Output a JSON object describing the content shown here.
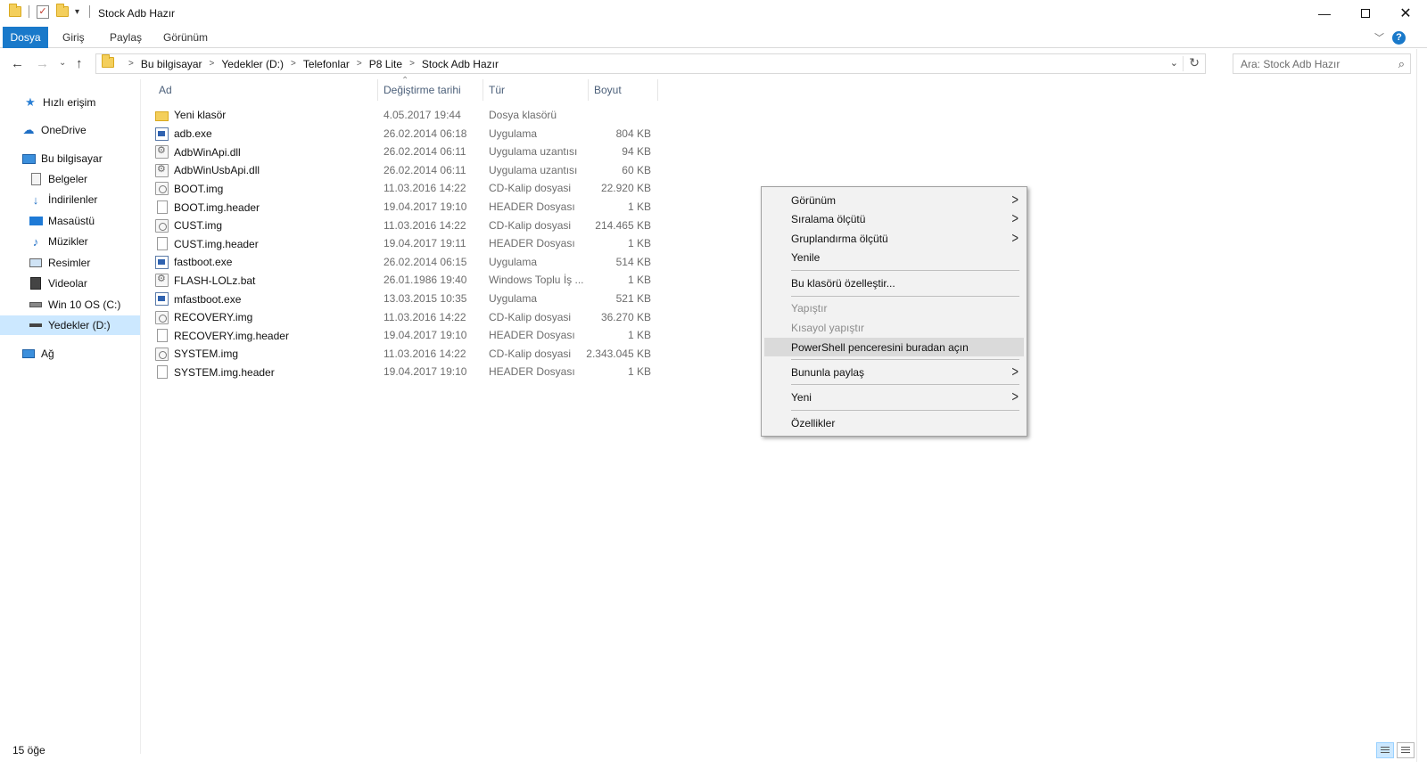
{
  "window": {
    "title": "Stock Adb Hazır",
    "minimize_icon": "minimize-icon",
    "maximize_icon": "maximize-icon",
    "close_icon": "close-icon"
  },
  "ribbon": {
    "tabs": [
      "Dosya",
      "Giriş",
      "Paylaş",
      "Görünüm"
    ],
    "accent": "#1979ca"
  },
  "address": {
    "breadcrumbs": [
      "Bu bilgisayar",
      "Yedekler (D:)",
      "Telefonlar",
      "P8 Lite",
      "Stock Adb Hazır"
    ]
  },
  "search": {
    "placeholder": "Ara: Stock Adb Hazır"
  },
  "nav": {
    "items": [
      {
        "label": "Hızlı erişim",
        "icon": "star-icon"
      },
      {
        "label": "OneDrive",
        "icon": "cloud-icon"
      },
      {
        "label": "Bu bilgisayar",
        "icon": "computer-icon"
      },
      {
        "label": "Belgeler",
        "icon": "documents-icon"
      },
      {
        "label": "İndirilenler",
        "icon": "download-icon"
      },
      {
        "label": "Masaüstü",
        "icon": "desktop-icon"
      },
      {
        "label": "Müzikler",
        "icon": "music-icon"
      },
      {
        "label": "Resimler",
        "icon": "pictures-icon"
      },
      {
        "label": "Videolar",
        "icon": "videos-icon"
      },
      {
        "label": "Win 10 OS (C:)",
        "icon": "drive-icon"
      },
      {
        "label": "Yedekler (D:)",
        "icon": "drive-icon"
      },
      {
        "label": "Ağ",
        "icon": "network-icon"
      }
    ]
  },
  "columns": {
    "name": "Ad",
    "date": "Değiştirme tarihi",
    "type": "Tür",
    "size": "Boyut"
  },
  "files": [
    {
      "name": "Yeni klasör",
      "date": "4.05.2017 19:44",
      "type": "Dosya klasörü",
      "size": "",
      "icon": "folder"
    },
    {
      "name": "adb.exe",
      "date": "26.02.2014 06:18",
      "type": "Uygulama",
      "size": "804 KB",
      "icon": "exe"
    },
    {
      "name": "AdbWinApi.dll",
      "date": "26.02.2014 06:11",
      "type": "Uygulama uzantısı",
      "size": "94 KB",
      "icon": "dll"
    },
    {
      "name": "AdbWinUsbApi.dll",
      "date": "26.02.2014 06:11",
      "type": "Uygulama uzantısı",
      "size": "60 KB",
      "icon": "dll"
    },
    {
      "name": "BOOT.img",
      "date": "11.03.2016 14:22",
      "type": "CD-Kalip dosyasi",
      "size": "22.920 KB",
      "icon": "img"
    },
    {
      "name": "BOOT.img.header",
      "date": "19.04.2017 19:10",
      "type": "HEADER Dosyası",
      "size": "1 KB",
      "icon": "doc"
    },
    {
      "name": "CUST.img",
      "date": "11.03.2016 14:22",
      "type": "CD-Kalip dosyasi",
      "size": "214.465 KB",
      "icon": "img"
    },
    {
      "name": "CUST.img.header",
      "date": "19.04.2017 19:11",
      "type": "HEADER Dosyası",
      "size": "1 KB",
      "icon": "doc"
    },
    {
      "name": "fastboot.exe",
      "date": "26.02.2014 06:15",
      "type": "Uygulama",
      "size": "514 KB",
      "icon": "exe"
    },
    {
      "name": "FLASH-LOLz.bat",
      "date": "26.01.1986 19:40",
      "type": "Windows Toplu İş ...",
      "size": "1 KB",
      "icon": "bat"
    },
    {
      "name": "mfastboot.exe",
      "date": "13.03.2015 10:35",
      "type": "Uygulama",
      "size": "521 KB",
      "icon": "exe"
    },
    {
      "name": "RECOVERY.img",
      "date": "11.03.2016 14:22",
      "type": "CD-Kalip dosyasi",
      "size": "36.270 KB",
      "icon": "img"
    },
    {
      "name": "RECOVERY.img.header",
      "date": "19.04.2017 19:10",
      "type": "HEADER Dosyası",
      "size": "1 KB",
      "icon": "doc"
    },
    {
      "name": "SYSTEM.img",
      "date": "11.03.2016 14:22",
      "type": "CD-Kalip dosyasi",
      "size": "2.343.045 KB",
      "icon": "img"
    },
    {
      "name": "SYSTEM.img.header",
      "date": "19.04.2017 19:10",
      "type": "HEADER Dosyası",
      "size": "1 KB",
      "icon": "doc"
    }
  ],
  "context_menu": {
    "items": [
      {
        "label": "Görünüm",
        "submenu": true,
        "disabled": false
      },
      {
        "label": "Sıralama ölçütü",
        "submenu": true,
        "disabled": false
      },
      {
        "label": "Gruplandırma ölçütü",
        "submenu": true,
        "disabled": false
      },
      {
        "label": "Yenile",
        "submenu": false,
        "disabled": false
      },
      {
        "label": "Bu klasörü özelleştir...",
        "submenu": false,
        "disabled": false
      },
      {
        "label": "Yapıştır",
        "submenu": false,
        "disabled": true
      },
      {
        "label": "Kısayol yapıştır",
        "submenu": false,
        "disabled": true
      },
      {
        "label": "PowerShell penceresini buradan açın",
        "submenu": false,
        "disabled": false,
        "highlighted": true
      },
      {
        "label": "Bununla paylaş",
        "submenu": true,
        "disabled": false
      },
      {
        "label": "Yeni",
        "submenu": true,
        "disabled": false
      },
      {
        "label": "Özellikler",
        "submenu": false,
        "disabled": false
      }
    ]
  },
  "status": {
    "item_count": "15 öğe"
  }
}
